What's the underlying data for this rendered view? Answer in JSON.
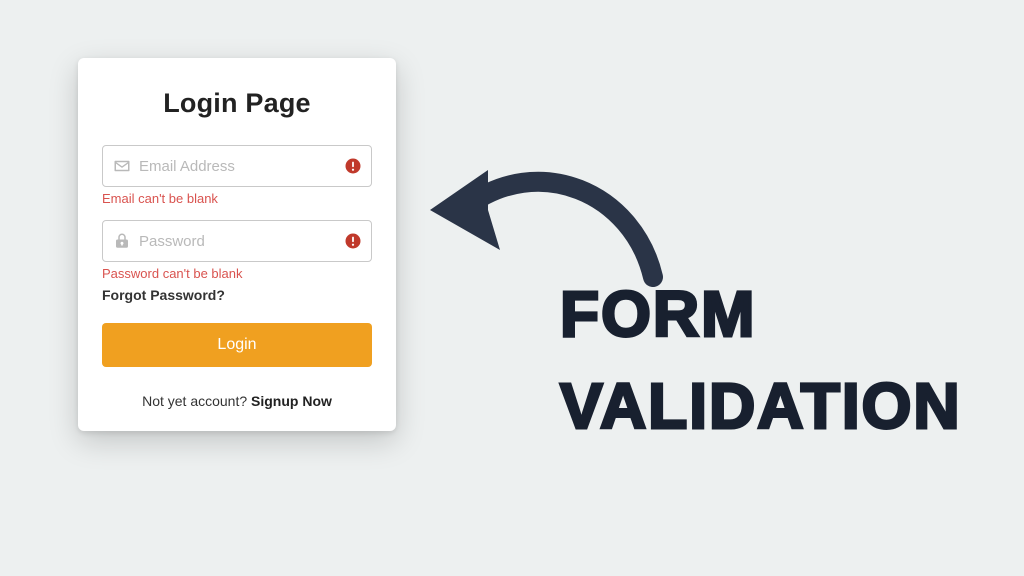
{
  "card": {
    "title": "Login Page",
    "email": {
      "placeholder": "Email Address",
      "value": "",
      "error": "Email can't be blank"
    },
    "password": {
      "placeholder": "Password",
      "value": "",
      "error": "Password can't be blank"
    },
    "forgot": "Forgot Password?",
    "login_label": "Login",
    "signup_prompt": "Not yet account? ",
    "signup_now": "Signup Now"
  },
  "headline": {
    "line1": "Form",
    "line2": "Validation"
  }
}
